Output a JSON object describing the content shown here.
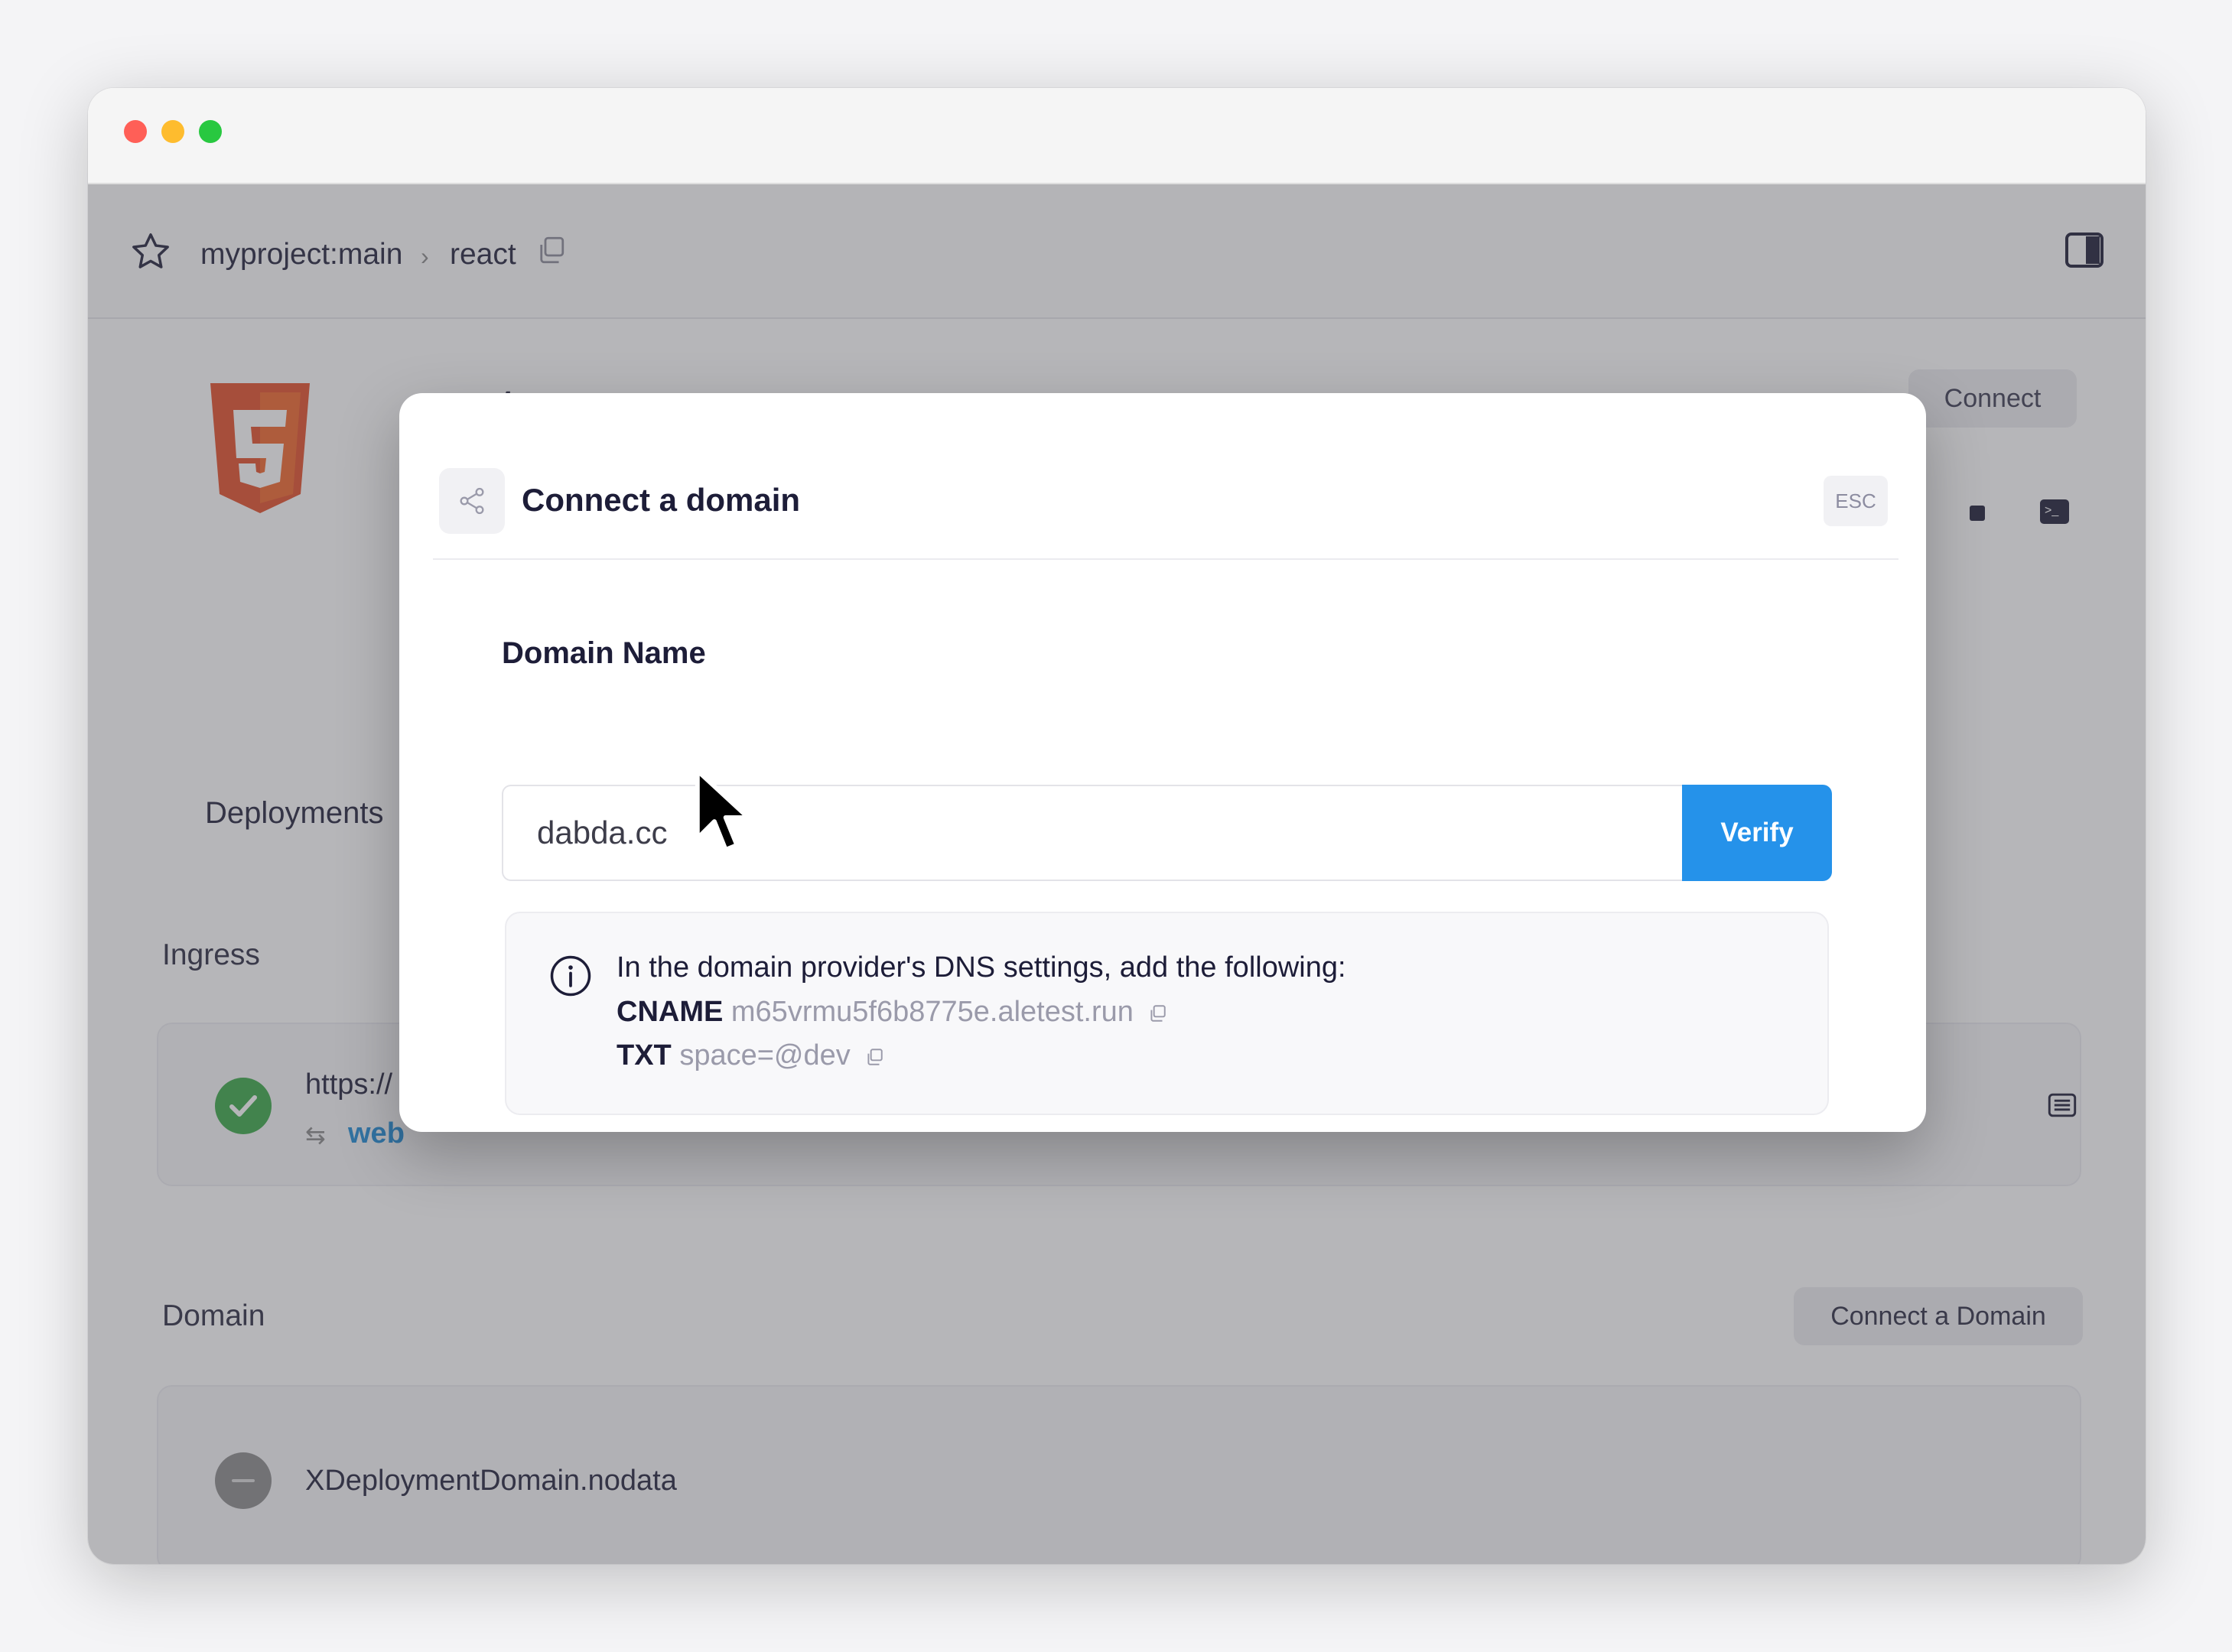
{
  "breadcrumb": {
    "project": "myproject:main",
    "separator": "›",
    "current": "react"
  },
  "hero": {
    "title": "react",
    "connect_label": "Connect"
  },
  "nav": {
    "deployments_label": "Deployments"
  },
  "ingress": {
    "title": "Ingress",
    "url": "https://",
    "sub": "web"
  },
  "domain_section": {
    "title": "Domain",
    "connect_button_label": "Connect a Domain",
    "value": "XDeploymentDomain.nodata"
  },
  "modal": {
    "title": "Connect a domain",
    "esc_label": "ESC",
    "field_label": "Domain Name",
    "domain_value": "dabda.cc",
    "verify_label": "Verify",
    "info_text": "In the domain provider's DNS settings, add the following:",
    "records": [
      {
        "type": "CNAME",
        "value": "m65vrmu5f6b8775e.aletest.run"
      },
      {
        "type": "TXT",
        "value": "space=@dev"
      }
    ]
  },
  "colors": {
    "accent": "#2592ea",
    "success": "#38a845",
    "html5_orange": "#e44d26"
  },
  "icons": {
    "star": "star-icon",
    "copy": "copy-icon",
    "sidebar": "sidebar-toggle-icon",
    "share": "share-icon",
    "info": "info-icon",
    "stop": "stop-icon",
    "terminal": "terminal-icon",
    "check": "check-icon",
    "list": "list-icon",
    "cursor": "cursor-icon"
  }
}
